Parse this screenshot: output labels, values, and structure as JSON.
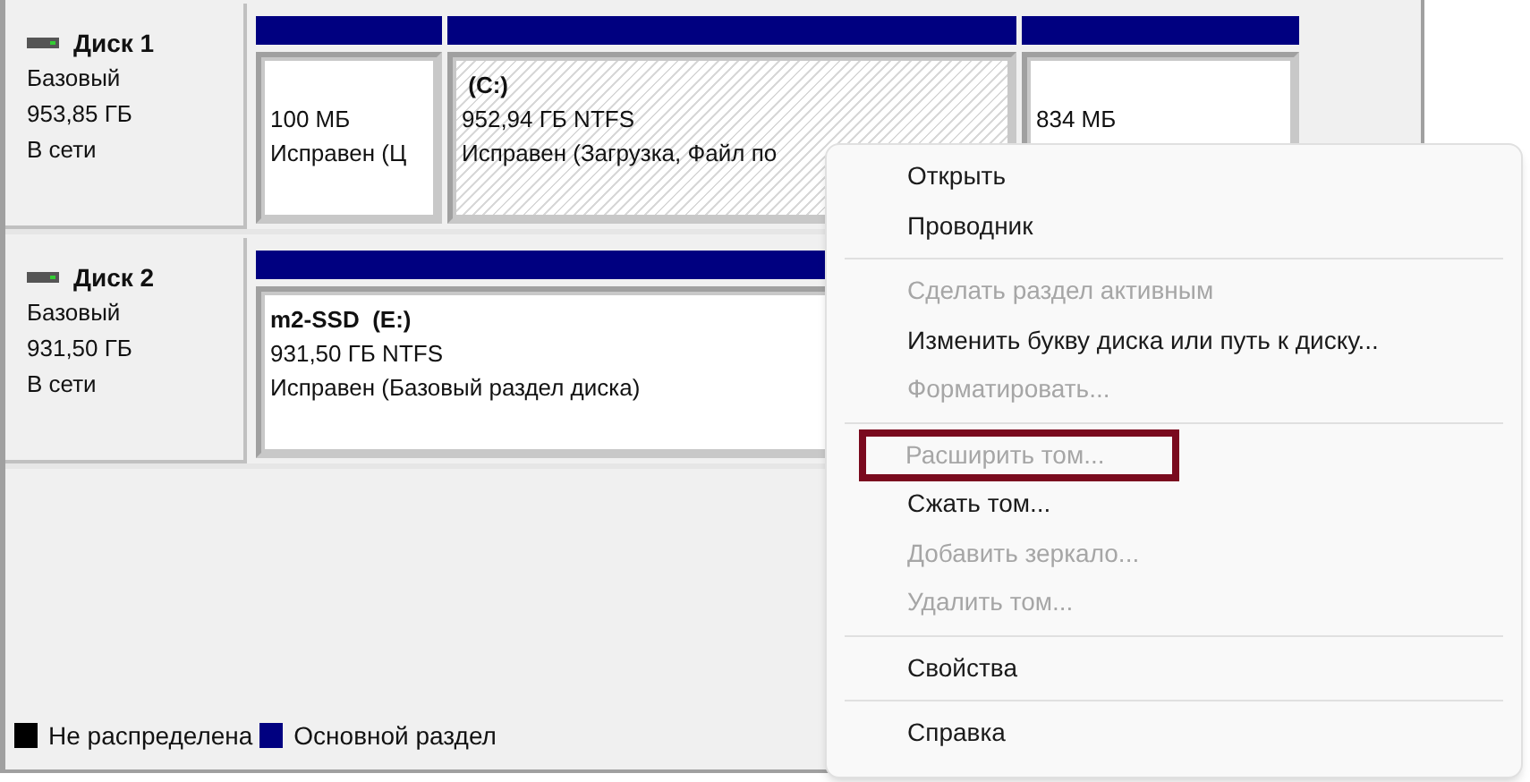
{
  "disks": [
    {
      "name": "Диск 1",
      "type": "Базовый",
      "size": "953,85 ГБ",
      "status": "В сети",
      "partitions": [
        {
          "kind": "plain",
          "size": "100 МБ",
          "health": "Исправен (Ц"
        },
        {
          "kind": "hatched",
          "label": " (C:)",
          "size": "952,94 ГБ NTFS",
          "health": "Исправен (Загрузка, Файл по"
        },
        {
          "kind": "plain",
          "size": "834 МБ"
        }
      ]
    },
    {
      "name": "Диск 2",
      "type": "Базовый",
      "size": "931,50 ГБ",
      "status": "В сети",
      "partitions": [
        {
          "kind": "plain",
          "label": "m2-SSD  (E:)",
          "size": "931,50 ГБ NTFS",
          "health": "Исправен (Базовый раздел диска)"
        }
      ]
    }
  ],
  "legend": [
    {
      "label": "Не распределена",
      "color": "#000000"
    },
    {
      "label": "Основной раздел",
      "color": "#000080"
    }
  ],
  "context_menu": [
    {
      "kind": "item",
      "label": "Открыть",
      "disabled": false,
      "highlighted": false
    },
    {
      "kind": "item",
      "label": "Проводник",
      "disabled": false,
      "highlighted": false
    },
    {
      "kind": "separator"
    },
    {
      "kind": "item",
      "label": "Сделать раздел активным",
      "disabled": true,
      "highlighted": false
    },
    {
      "kind": "item",
      "label": "Изменить букву диска или путь к диску...",
      "disabled": false,
      "highlighted": false
    },
    {
      "kind": "item",
      "label": "Форматировать...",
      "disabled": true,
      "highlighted": false
    },
    {
      "kind": "separator"
    },
    {
      "kind": "item",
      "label": "Расширить том...",
      "disabled": true,
      "highlighted": true
    },
    {
      "kind": "item",
      "label": "Сжать том...",
      "disabled": false,
      "highlighted": false
    },
    {
      "kind": "item",
      "label": "Добавить зеркало...",
      "disabled": true,
      "highlighted": false
    },
    {
      "kind": "item",
      "label": "Удалить том...",
      "disabled": true,
      "highlighted": false
    },
    {
      "kind": "separator"
    },
    {
      "kind": "item",
      "label": "Свойства",
      "disabled": false,
      "highlighted": false
    },
    {
      "kind": "separator"
    },
    {
      "kind": "item",
      "label": "Справка",
      "disabled": false,
      "highlighted": false
    }
  ]
}
